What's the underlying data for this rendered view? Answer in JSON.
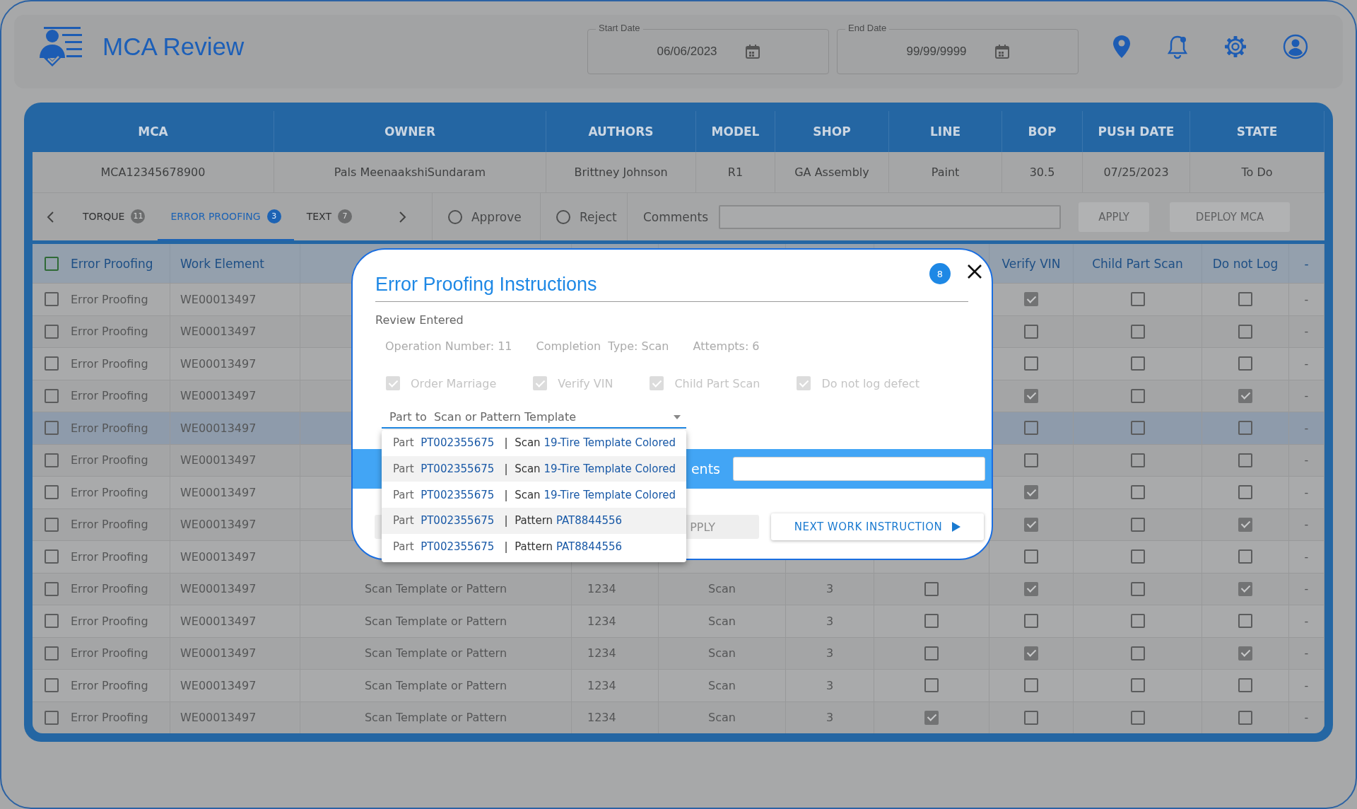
{
  "app": {
    "title": "MCA Review"
  },
  "date_filters": [
    {
      "label": "Start Date",
      "value": "06/06/2023"
    },
    {
      "label": "End Date",
      "value": "99/99/9999"
    }
  ],
  "mca_table": {
    "columns": [
      "MCA",
      "OWNER",
      "AUTHORS",
      "MODEL",
      "SHOP",
      "LINE",
      "BOP",
      "PUSH DATE",
      "STATE"
    ],
    "rows": [
      [
        "MCA12345678900",
        "Pals MeenaakshiSundaram",
        "Brittney Johnson",
        "R1",
        "GA Assembly",
        "Paint",
        "30.5",
        "07/25/2023",
        "To Do"
      ]
    ]
  },
  "tabs": [
    {
      "label": "TORQUE",
      "count": "11",
      "selected": false
    },
    {
      "label": "ERROR PROOFING",
      "count": "3",
      "selected": true
    },
    {
      "label": "TEXT",
      "count": "7",
      "selected": false
    }
  ],
  "review": {
    "options": [
      {
        "label": "Approve",
        "selected": false
      },
      {
        "label": "Reject",
        "selected": false
      }
    ],
    "comments_label": "Comments",
    "buttons": [
      {
        "label": "APPLY",
        "disabled": true
      },
      {
        "label": "DEPLOY MCA",
        "disabled": true
      }
    ]
  },
  "instructions": {
    "header": {
      "select_all_checked": false,
      "type": "Error Proofing",
      "work_element": "Work Element",
      "verify_vin": "Verify VIN",
      "child_part_scan": "Child Part Scan",
      "do_not_log": "Do not Log",
      "column_11": "-"
    },
    "rows": [
      {
        "checked": false,
        "selected": false,
        "type": "Error Proofing",
        "work_element": "WE00013497",
        "verify_vin": true,
        "child_part_scan": false,
        "do_not_log": false,
        "column_11": "-"
      },
      {
        "checked": false,
        "selected": false,
        "type": "Error Proofing",
        "work_element": "WE00013497",
        "verify_vin": false,
        "child_part_scan": false,
        "do_not_log": false,
        "column_11": "-"
      },
      {
        "checked": false,
        "selected": false,
        "type": "Error Proofing",
        "work_element": "WE00013497",
        "verify_vin": false,
        "child_part_scan": false,
        "do_not_log": false,
        "column_11": "-"
      },
      {
        "checked": false,
        "selected": false,
        "type": "Error Proofing",
        "work_element": "WE00013497",
        "verify_vin": true,
        "child_part_scan": false,
        "do_not_log": true,
        "column_11": "-"
      },
      {
        "checked": false,
        "selected": true,
        "type": "Error Proofing",
        "work_element": "WE00013497",
        "verify_vin": false,
        "child_part_scan": false,
        "do_not_log": false,
        "column_11": "-"
      },
      {
        "checked": false,
        "selected": false,
        "type": "Error Proofing",
        "work_element": "WE00013497",
        "verify_vin": false,
        "child_part_scan": false,
        "do_not_log": false,
        "column_11": "-"
      },
      {
        "checked": false,
        "selected": false,
        "type": "Error Proofing",
        "work_element": "WE00013497",
        "verify_vin": true,
        "child_part_scan": false,
        "do_not_log": false,
        "column_11": "-"
      },
      {
        "checked": false,
        "selected": false,
        "type": "Error Proofing",
        "work_element": "WE00013497",
        "verify_vin": true,
        "child_part_scan": false,
        "do_not_log": true,
        "column_11": "-"
      },
      {
        "checked": false,
        "selected": false,
        "type": "Error Proofing",
        "work_element": "WE00013497",
        "verify_vin": false,
        "child_part_scan": false,
        "do_not_log": false,
        "column_11": "-"
      },
      {
        "checked": false,
        "selected": false,
        "type": "Error Proofing",
        "work_element": "WE00013497",
        "column_3": "Scan Template or Pattern",
        "column_4": "1234",
        "column_5": "Scan",
        "column_6": "3",
        "column_7": false,
        "verify_vin": true,
        "child_part_scan": false,
        "do_not_log": true,
        "column_11": "-"
      },
      {
        "checked": false,
        "selected": false,
        "type": "Error Proofing",
        "work_element": "WE00013497",
        "column_3": "Scan Template or Pattern",
        "column_4": "1234",
        "column_5": "Scan",
        "column_6": "3",
        "column_7": false,
        "verify_vin": false,
        "child_part_scan": false,
        "do_not_log": false,
        "column_11": "-"
      },
      {
        "checked": false,
        "selected": false,
        "type": "Error Proofing",
        "work_element": "WE00013497",
        "column_3": "Scan Template or Pattern",
        "column_4": "1234",
        "column_5": "Scan",
        "column_6": "3",
        "column_7": false,
        "verify_vin": true,
        "child_part_scan": false,
        "do_not_log": true,
        "column_11": "-"
      },
      {
        "checked": false,
        "selected": false,
        "type": "Error Proofing",
        "work_element": "WE00013497",
        "column_3": "Scan Template or Pattern",
        "column_4": "1234",
        "column_5": "Scan",
        "column_6": "3",
        "column_7": false,
        "verify_vin": false,
        "child_part_scan": false,
        "do_not_log": false,
        "column_11": "-"
      },
      {
        "checked": false,
        "selected": false,
        "type": "Error Proofing",
        "work_element": "WE00013497",
        "column_3": "Scan Template or Pattern",
        "column_4": "1234",
        "column_5": "Scan",
        "column_6": "3",
        "column_7": true,
        "verify_vin": false,
        "child_part_scan": false,
        "do_not_log": false,
        "column_11": "-"
      }
    ]
  },
  "dialog": {
    "title": "Error Proofing Instructions",
    "badge": "8",
    "section": "Review Entered",
    "details": [
      "Operation Number: 11",
      "Completion  Type: Scan",
      "Attempts: 6"
    ],
    "flags": [
      {
        "label": "Order Marriage",
        "checked": true,
        "disabled": true
      },
      {
        "label": "Verify VIN",
        "checked": true,
        "disabled": true
      },
      {
        "label": "Child Part Scan",
        "checked": true,
        "disabled": true
      },
      {
        "label": "Do not log defect",
        "checked": true,
        "disabled": true
      }
    ],
    "part_select": {
      "placeholder": "Part to  Scan or Pattern Template",
      "expanded": true,
      "options": [
        {
          "prefix": "Part",
          "part": "PT002355675",
          "separator": "|",
          "type": "Scan",
          "value": "19-Tire Template Colored"
        },
        {
          "prefix": "Part",
          "part": "PT002355675",
          "separator": "|",
          "type": "Scan",
          "value": "19-Tire Template Colored"
        },
        {
          "prefix": "Part",
          "part": "PT002355675",
          "separator": "|",
          "type": "Scan",
          "value": "19-Tire Template Colored"
        },
        {
          "prefix": "Part",
          "part": "PT002355675",
          "separator": "|",
          "type": "Pattern",
          "value": "PAT8844556"
        },
        {
          "prefix": "Part",
          "part": "PT002355675",
          "separator": "|",
          "type": "Pattern",
          "value": "PAT8844556"
        }
      ]
    },
    "comments_label": "ents",
    "apply_button": {
      "label": "PPLY",
      "disabled": true
    },
    "next_button": {
      "label": "NEXT WORK INSTRUCTION"
    }
  }
}
